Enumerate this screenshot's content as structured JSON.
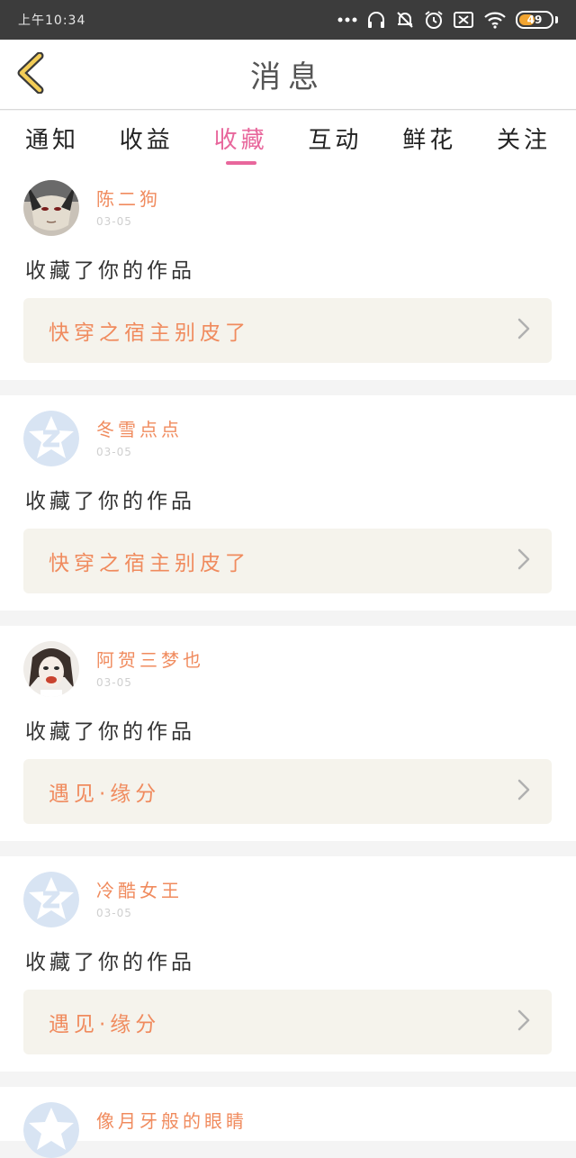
{
  "status_bar": {
    "time": "上午10:34",
    "battery": "49",
    "battery_level": 0.49
  },
  "header": {
    "title": "消息"
  },
  "tabs": [
    {
      "label": "通知",
      "active": false
    },
    {
      "label": "收益",
      "active": false
    },
    {
      "label": "收藏",
      "active": true
    },
    {
      "label": "互动",
      "active": false
    },
    {
      "label": "鲜花",
      "active": false
    },
    {
      "label": "关注",
      "active": false
    }
  ],
  "colors": {
    "accent": "#e8679c",
    "name": "#f08b5e",
    "card_link_bg": "#f5f3ec",
    "status_bg": "#3c3c3c"
  },
  "feed": [
    {
      "name": "陈二狗",
      "date": "03-05",
      "action": "收藏了你的作品",
      "work": "快穿之宿主别皮了",
      "avatar": "anime-photo-avatar"
    },
    {
      "name": "冬雪点点",
      "date": "03-05",
      "action": "收藏了你的作品",
      "work": "快穿之宿主别皮了",
      "avatar": "default-star-avatar"
    },
    {
      "name": "阿贺三梦也",
      "date": "03-05",
      "action": "收藏了你的作品",
      "work": "遇见·缘分",
      "avatar": "doll-photo-avatar"
    },
    {
      "name": "冷酷女王",
      "date": "03-05",
      "action": "收藏了你的作品",
      "work": "遇见·缘分",
      "avatar": "default-star-avatar"
    }
  ],
  "partial_item": {
    "name": "像月牙般的眼睛"
  }
}
